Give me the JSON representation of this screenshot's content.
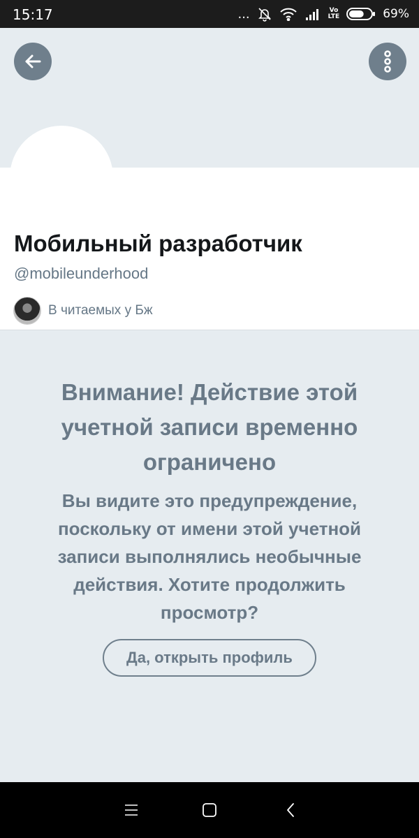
{
  "status_bar": {
    "time": "15:17",
    "dots": "...",
    "battery_percent": "69%",
    "battery_level": 0.69,
    "network_label_top": "Vo",
    "network_label_bottom": "LTE"
  },
  "header": {
    "back_icon": "arrow-left-icon",
    "more_icon": "more-vertical-icon",
    "button_color": "#6f7f8c"
  },
  "profile": {
    "display_name": "Мобильный разработчик",
    "handle": "@mobileunderhood",
    "followed_by": "В читаемых у Бж"
  },
  "warning": {
    "title": "Внимание! Действие этой учетной записи временно ограничено",
    "body": "Вы видите это предупреждение, поскольку от имени этой учетной записи выполнялись необычные действия. Хотите продолжить просмотр?",
    "button_label": "Да, открыть профиль"
  },
  "nav_bar": {
    "icons": [
      "menu-icon",
      "home-square-icon",
      "back-chevron-icon"
    ]
  },
  "colors": {
    "background": "#e6ecf0",
    "muted_text": "#697987",
    "name_text": "#14171a"
  }
}
